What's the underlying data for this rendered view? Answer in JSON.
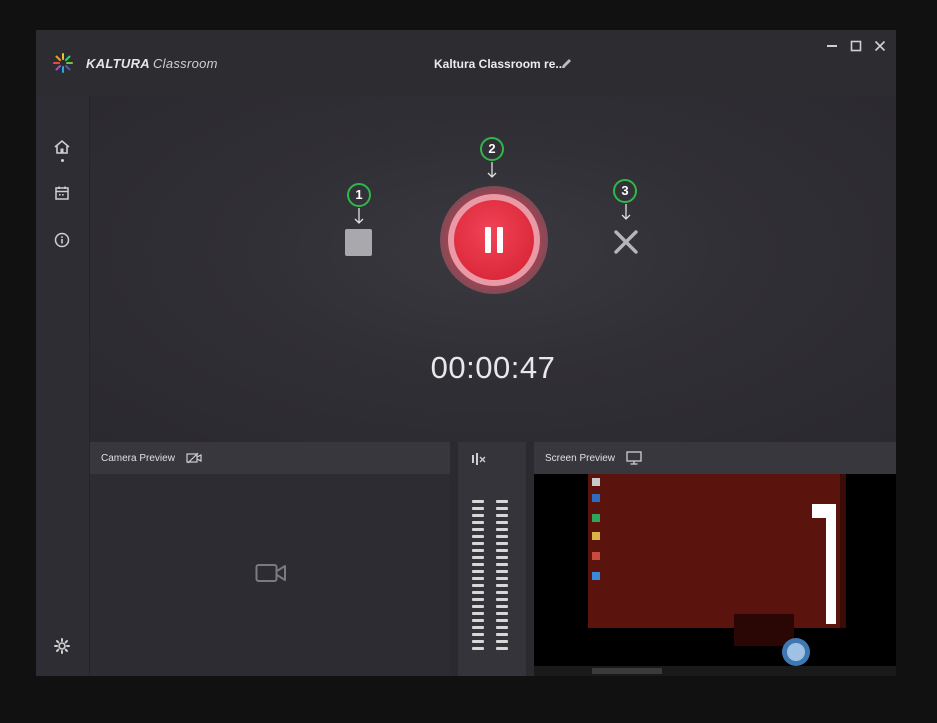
{
  "app": {
    "brand_name": "KALTURA",
    "brand_sub": "Classroom",
    "recording_title": "Kaltura Classroom re...",
    "accent_color": "#dc2a3c"
  },
  "window_controls": {
    "minimize": "minimize-icon",
    "maximize": "maximize-icon",
    "close": "close-icon"
  },
  "sidebar": {
    "items": [
      {
        "name": "home",
        "icon": "home-icon"
      },
      {
        "name": "schedule",
        "icon": "calendar-icon"
      },
      {
        "name": "info",
        "icon": "info-icon"
      }
    ],
    "settings_icon": "gear-icon"
  },
  "recording": {
    "timer": "00:00:47",
    "annotations": [
      "1",
      "2",
      "3"
    ]
  },
  "camera_preview": {
    "label": "Camera Preview"
  },
  "screen_preview": {
    "label": "Screen Preview"
  }
}
